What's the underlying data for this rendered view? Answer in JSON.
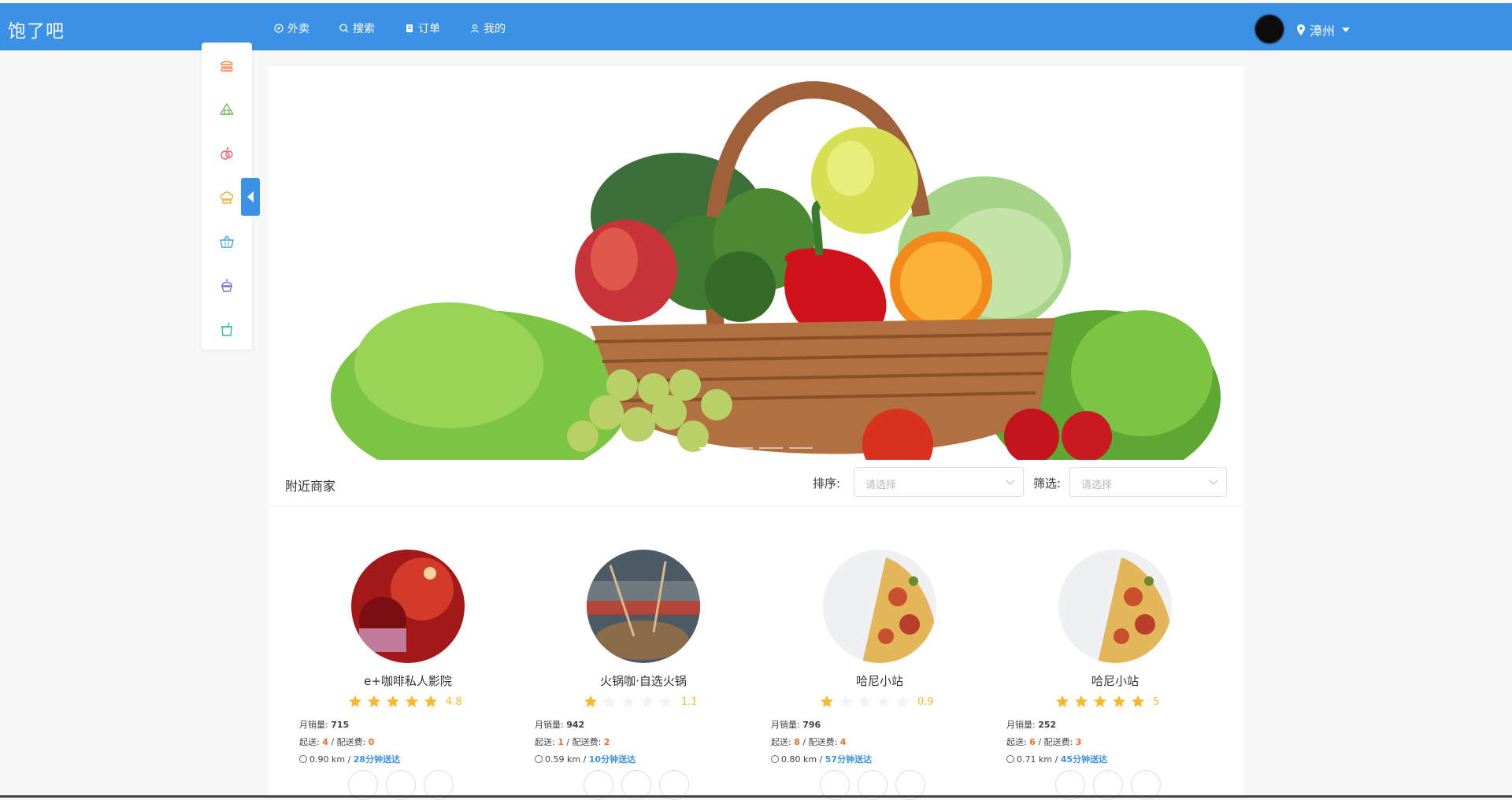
{
  "header": {
    "logo": "饱了吧",
    "nav": [
      {
        "label": "外卖",
        "icon": "compass-icon"
      },
      {
        "label": "搜索",
        "icon": "search-icon"
      },
      {
        "label": "订单",
        "icon": "order-icon"
      },
      {
        "label": "我的",
        "icon": "user-icon"
      }
    ],
    "city": "漳州",
    "colors": {
      "primary": "#3a91e6"
    }
  },
  "categories": [
    {
      "icon": "burger-icon",
      "color": "#f0884a"
    },
    {
      "icon": "rice-ball-icon",
      "color": "#6dbf5c"
    },
    {
      "icon": "fruit-icon",
      "color": "#ef5f6a"
    },
    {
      "icon": "chef-hat-icon",
      "color": "#f0b23c"
    },
    {
      "icon": "basket-icon",
      "color": "#3aa6e0"
    },
    {
      "icon": "cupcake-icon",
      "color": "#7d6fd9"
    },
    {
      "icon": "drink-icon",
      "color": "#2fbf86"
    }
  ],
  "banner": {
    "dots": 4,
    "active_index": 0
  },
  "section": {
    "title": "附近商家",
    "sort_label": "排序:",
    "sort_placeholder": "请选择",
    "filter_label": "筛选:",
    "filter_placeholder": "请选择"
  },
  "labels": {
    "monthly_sales": "月销量:",
    "min_order": "起送:",
    "delivery_fee": "配送费:",
    "separator": " / "
  },
  "shops": [
    {
      "name": "e+咖啡私人影院",
      "rating": "4.8",
      "stars": 5,
      "monthly_sales": "715",
      "min_order": "4",
      "delivery_fee": "0",
      "distance": "0.90 km",
      "time": "28分钟送达"
    },
    {
      "name": "火锅咖·自选火锅",
      "rating": "1.1",
      "stars": 1,
      "monthly_sales": "942",
      "min_order": "1",
      "delivery_fee": "2",
      "distance": "0.59 km",
      "time": "10分钟送达"
    },
    {
      "name": "哈尼小站",
      "rating": "0.9",
      "stars": 1,
      "monthly_sales": "796",
      "min_order": "8",
      "delivery_fee": "4",
      "distance": "0.80 km",
      "time": "57分钟送达"
    },
    {
      "name": "哈尼小站",
      "rating": "5",
      "stars": 5,
      "monthly_sales": "252",
      "min_order": "6",
      "delivery_fee": "3",
      "distance": "0.71 km",
      "time": "45分钟送达"
    }
  ]
}
